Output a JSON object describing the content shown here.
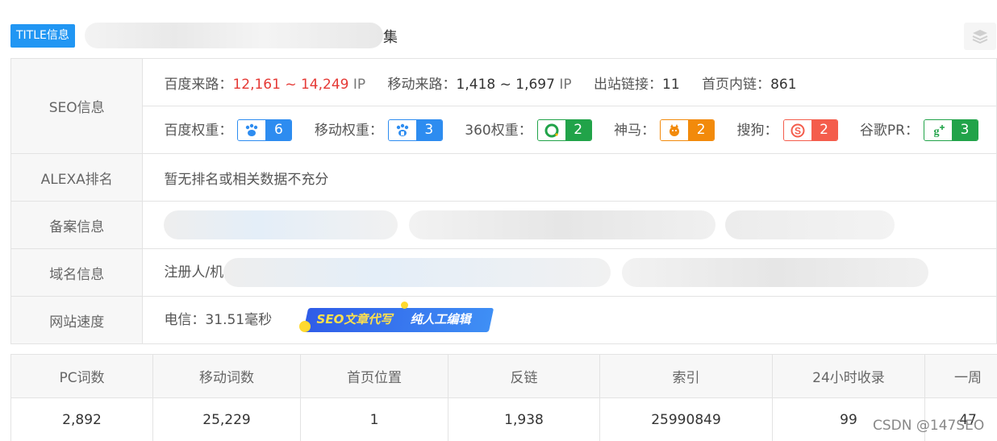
{
  "title_row": {
    "badge": "TITLE信息",
    "tail_char": "集"
  },
  "seo": {
    "label": "SEO信息",
    "row1": [
      {
        "key": "百度来路：",
        "value": "12,161 ~ 14,249",
        "unit": "IP",
        "color": "#e53935"
      },
      {
        "key": "移动来路：",
        "value": "1,418 ~ 1,697",
        "unit": "IP",
        "color": "#333333"
      },
      {
        "key": "出站链接：",
        "value": "11"
      },
      {
        "key": "首页内链：",
        "value": "861"
      }
    ],
    "row2": [
      {
        "key": "百度权重：",
        "icon": "baidu-paw-icon",
        "value": "6",
        "color": "#2d8cf0"
      },
      {
        "key": "移动权重：",
        "icon": "baidu-mobile-icon",
        "value": "3",
        "color": "#2d8cf0"
      },
      {
        "key": "360权重：",
        "icon": "360-ring-icon",
        "value": "2",
        "color": "#21a349"
      },
      {
        "key": "神马：",
        "icon": "shenma-icon",
        "value": "2",
        "color": "#f28a0b"
      },
      {
        "key": "搜狗：",
        "icon": "sogou-icon",
        "value": "2",
        "color": "#f45d4c"
      },
      {
        "key": "谷歌PR：",
        "icon": "google-plus-icon",
        "value": "3",
        "color": "#21a349"
      }
    ]
  },
  "alexa": {
    "label": "ALEXA排名",
    "value": "暂无排名或相关数据不充分"
  },
  "beian": {
    "label": "备案信息"
  },
  "domain": {
    "label": "域名信息",
    "prefix": "注册人/机"
  },
  "speed": {
    "label": "网站速度",
    "value": "电信：31.51毫秒",
    "ad_text1": "SEO文章代写",
    "ad_text2": "纯人工编辑"
  },
  "stats": {
    "headers": [
      "PC词数",
      "移动词数",
      "首页位置",
      "反链",
      "索引",
      "24小时收录",
      "一周"
    ],
    "values": [
      "2,892",
      "25,229",
      "1",
      "1,938",
      "25990849",
      "99",
      "47"
    ]
  },
  "watermark": "CSDN @147SEO"
}
